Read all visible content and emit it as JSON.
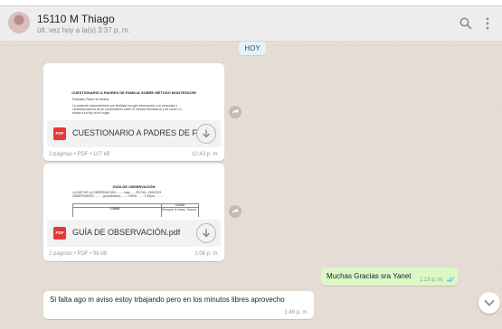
{
  "header": {
    "contact_name": "15110 M Thiago",
    "last_seen": "últ. vez hoy a la(s) 3:37 p. m.",
    "icons": [
      "avatar",
      "search-icon",
      "menu-icon"
    ]
  },
  "date_chip": "HOY",
  "documents": [
    {
      "preview": {
        "title": "CUESTIONARIO A PADRES DE FAMILIA SOBRE MÉTODO MONTESSORI",
        "greeting": "Estimado Padre de familia:",
        "body_lines": [
          "La presente encuesta tiene por finalidad recoger información con veracidad y",
          "veracidad acerca de su conocimiento sobre el método Montessori y de cómo LG.",
          "educa a su hijo en el hogar."
        ]
      },
      "file_label": "PDF",
      "file_name": "CUESTIONARIO A PADRES DE FAM...",
      "meta": "2 páginas • PDF • 107 kB",
      "time": "12:43 p. m."
    },
    {
      "preview": {
        "title": "GUÍA DE OBSERVACIÓN",
        "lines": [
          "LUGAR DE LA OBSERVACIÓN: ........sala...... FECHA: 13/6/2021",
          "OBSERVADOR: .........(practicante)........ HORA: .......1:30pm........."
        ],
        "table_headers": [
          "ITEMS",
          "Escala",
          "Siempre",
          "A veces",
          "Nunca"
        ]
      },
      "file_label": "PDF",
      "file_name": "GUÍA DE OBSERVACIÓN.pdf",
      "meta": "2 páginas • PDF • 96 kB",
      "time": "1:08 p. m."
    }
  ],
  "outgoing_message": {
    "text": "Muchas Gracias sra Yanet",
    "time": "1:19 p. m.",
    "status": "read"
  },
  "incoming_message": {
    "text": "Si falta ago m aviso estoy trbajando pero en los minutos  libres aprovecho",
    "time": "1:46 p. m."
  },
  "colors": {
    "chat_bg": "#e5ddd5",
    "outgoing_bg": "#dcf8c6",
    "pdf_red": "#e53935",
    "read_ticks": "#4fc3f7"
  }
}
